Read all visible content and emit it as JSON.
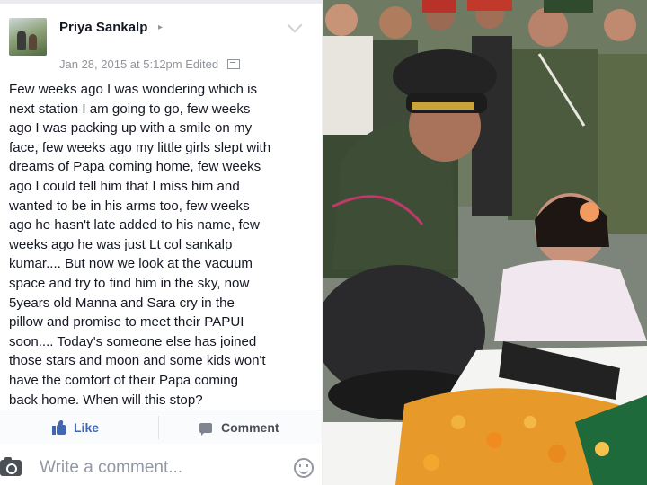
{
  "post": {
    "author": "Priya Sankalp",
    "timestamp": "Jan 28, 2015 at 5:12pm",
    "edited_label": "Edited",
    "body_lines": [
      "Few weeks ago I was wondering which is",
      "next station I am going to go, few weeks",
      "ago I was packing up with a smile on my",
      "face, few weeks ago my little girls slept with",
      "dreams of Papa coming home, few weeks",
      "ago I could tell him that I miss him and",
      "wanted to be in his arms too, few weeks",
      "ago he hasn't late added to his name, few",
      "weeks ago he was just Lt col sankalp",
      "kumar.... But now we look at the vacuum",
      "space and try to find him in the sky, now",
      "5years old Manna and Sara cry in the",
      "pillow and promise to meet their PAPUI",
      "soon.... Today's someone else has joined",
      "those stars and moon and some kids won't",
      "have the comfort of their Papa coming",
      "back home. When will this stop?"
    ]
  },
  "actions": {
    "like_label": "Like",
    "comment_label": "Comment"
  },
  "composer": {
    "placeholder": "Write a comment..."
  },
  "colors": {
    "facebook_blue": "#4267b2",
    "text_primary": "#141823",
    "text_meta": "#90949c"
  },
  "icons": [
    "avatar",
    "chevron-down-icon",
    "privacy-icon",
    "like-icon",
    "comment-icon",
    "camera-icon",
    "smiley-icon"
  ]
}
